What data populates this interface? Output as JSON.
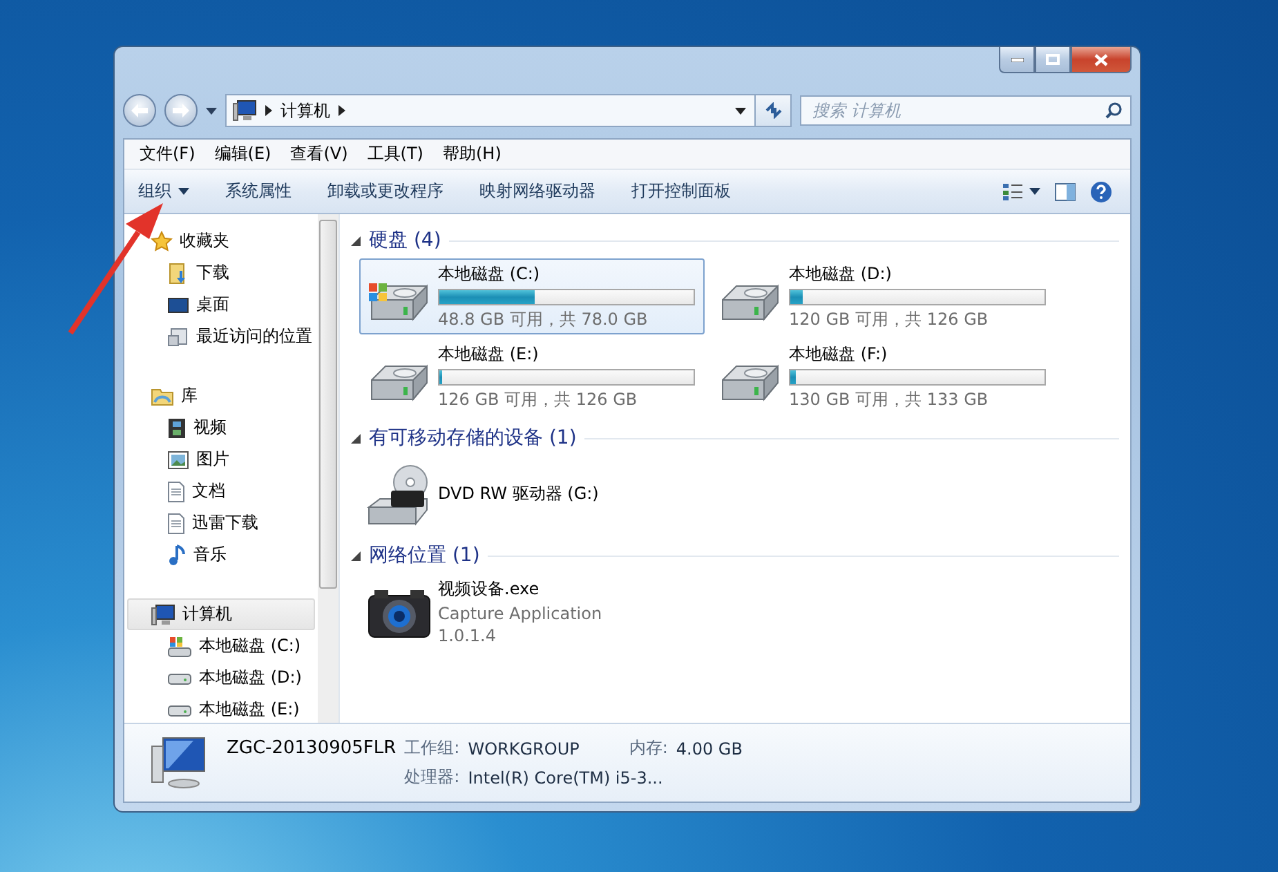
{
  "address": {
    "path": [
      "计算机"
    ]
  },
  "search": {
    "placeholder": "搜索 计算机"
  },
  "menu": [
    "文件(F)",
    "编辑(E)",
    "查看(V)",
    "工具(T)",
    "帮助(H)"
  ],
  "commands": [
    {
      "label": "组织",
      "dropdown": true
    },
    {
      "label": "系统属性",
      "dropdown": false
    },
    {
      "label": "卸载或更改程序",
      "dropdown": false
    },
    {
      "label": "映射网络驱动器",
      "dropdown": false
    },
    {
      "label": "打开控制面板",
      "dropdown": false
    }
  ],
  "nav": [
    {
      "label": "收藏夹",
      "kind": "star",
      "selected": false,
      "children": [
        {
          "label": "下载",
          "kind": "download",
          "selected": false
        },
        {
          "label": "桌面",
          "kind": "desktop",
          "selected": false
        },
        {
          "label": "最近访问的位置",
          "kind": "recent",
          "selected": false
        }
      ]
    },
    {
      "label": "库",
      "kind": "library",
      "selected": false,
      "children": [
        {
          "label": "视频",
          "kind": "video",
          "selected": false
        },
        {
          "label": "图片",
          "kind": "picture",
          "selected": false
        },
        {
          "label": "文档",
          "kind": "document",
          "selected": false
        },
        {
          "label": "迅雷下载",
          "kind": "document",
          "selected": false
        },
        {
          "label": "音乐",
          "kind": "music",
          "selected": false
        }
      ]
    },
    {
      "label": "计算机",
      "kind": "computer",
      "selected": true,
      "children": [
        {
          "label": "本地磁盘 (C:)",
          "kind": "system-drive",
          "selected": false
        },
        {
          "label": "本地磁盘 (D:)",
          "kind": "drive",
          "selected": false
        },
        {
          "label": "本地磁盘 (E:)",
          "kind": "drive",
          "selected": false
        }
      ]
    }
  ],
  "groups": [
    {
      "title": "硬盘 (4)",
      "expanded": true,
      "items": [
        {
          "kind": "system-drive",
          "name": "本地磁盘 (C:)",
          "level": 0.374,
          "info": "48.8 GB 可用，共 78.0 GB",
          "selected": true
        },
        {
          "kind": "drive",
          "name": "本地磁盘 (D:)",
          "level": 0.048,
          "info": "120 GB 可用，共 126 GB",
          "selected": false
        },
        {
          "kind": "drive",
          "name": "本地磁盘 (E:)",
          "level": 0.004,
          "info": "126 GB 可用，共 126 GB",
          "selected": false
        },
        {
          "kind": "drive",
          "name": "本地磁盘 (F:)",
          "level": 0.023,
          "info": "130 GB 可用，共 133 GB",
          "selected": false
        }
      ]
    },
    {
      "title": "有可移动存储的设备 (1)",
      "expanded": true,
      "items": [
        {
          "kind": "dvd",
          "name": "DVD RW 驱动器 (G:)",
          "selected": false
        }
      ]
    },
    {
      "title": "网络位置 (1)",
      "expanded": true,
      "items": [
        {
          "kind": "app",
          "name": "视频设备.exe",
          "description": "Capture Application",
          "version": "1.0.1.4",
          "selected": false
        }
      ]
    }
  ],
  "details": {
    "name": "ZGC-20130905FLR",
    "fields": [
      {
        "label": "工作组:",
        "value": "WORKGROUP"
      },
      {
        "label": "内存:",
        "value": "4.00 GB"
      },
      {
        "label": "处理器:",
        "value": "Intel(R) Core(TM) i5-3..."
      }
    ]
  }
}
